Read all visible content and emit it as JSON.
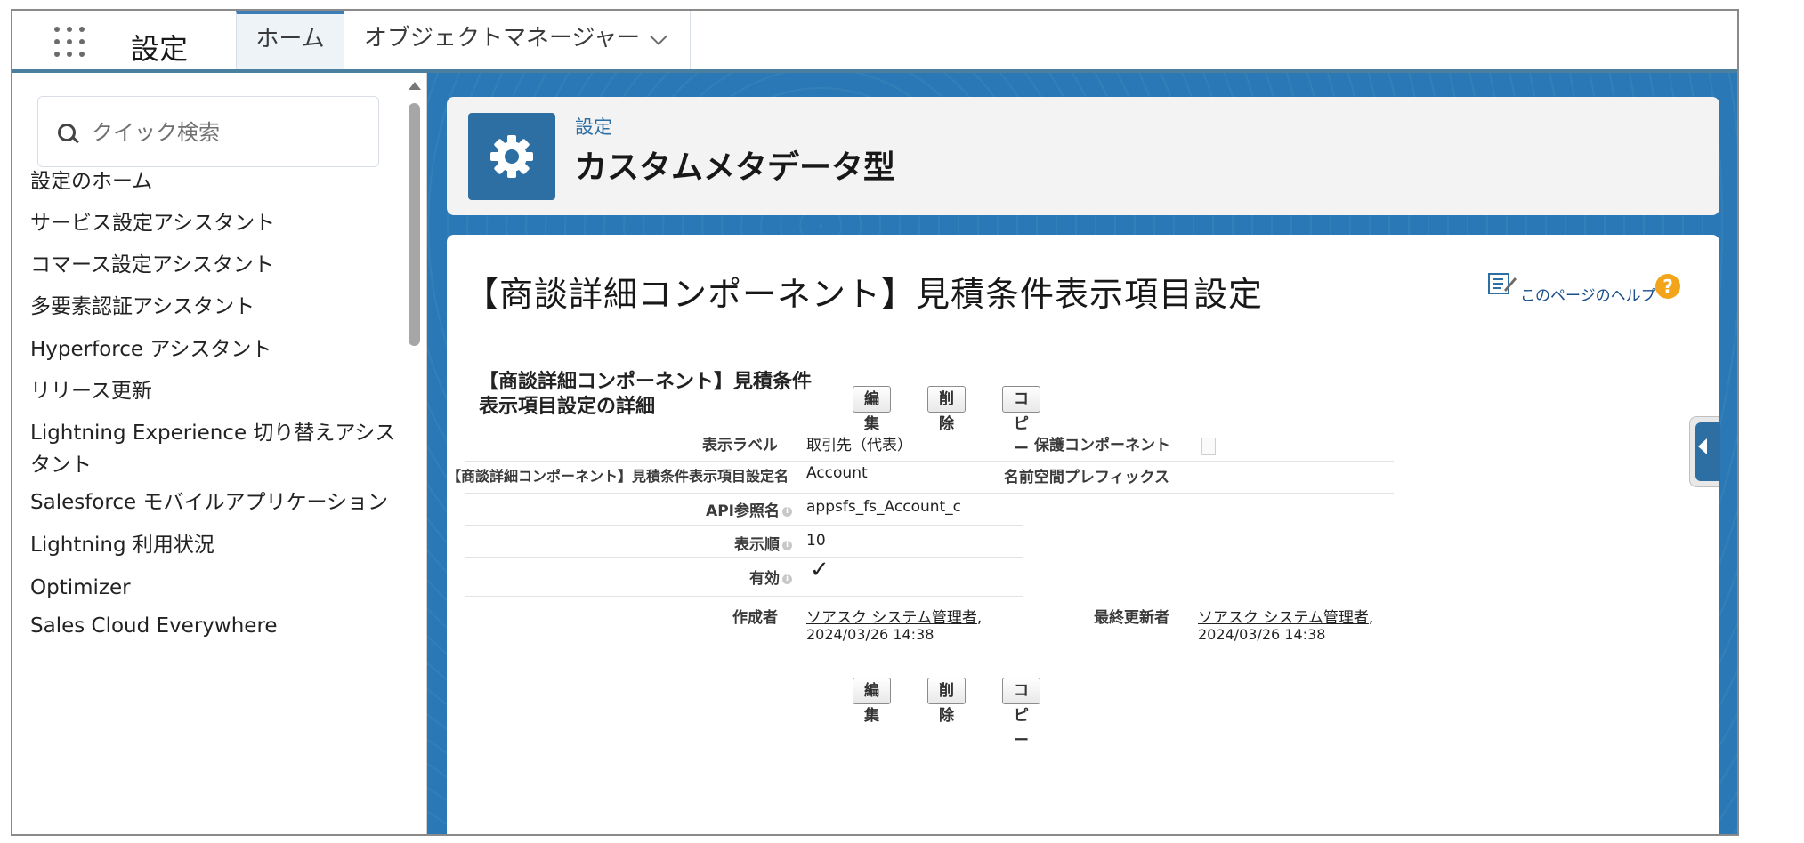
{
  "topbar": {
    "app_name": "設定",
    "tabs": [
      {
        "label": "ホーム"
      },
      {
        "label": "オブジェクトマネージャー"
      }
    ]
  },
  "sidebar": {
    "search_placeholder": "クイック検索",
    "items": [
      {
        "label": "設定のホーム"
      },
      {
        "label": "サービス設定アシスタント"
      },
      {
        "label": "コマース設定アシスタント"
      },
      {
        "label": "多要素認証アシスタント"
      },
      {
        "label": "Hyperforce アシスタント"
      },
      {
        "label": "リリース更新"
      },
      {
        "label": "Lightning Experience 切り替えアシスタント"
      },
      {
        "label": "Salesforce モバイルアプリケーション"
      },
      {
        "label": "Lightning 利用状況"
      },
      {
        "label": "Optimizer"
      },
      {
        "label": "Sales Cloud Everywhere"
      }
    ]
  },
  "header": {
    "breadcrumb": "設定",
    "title": "カスタムメタデータ型"
  },
  "content": {
    "title": "【商談詳細コンポーネント】見積条件表示項目設定",
    "help_text": "このページのヘルプ",
    "detail_title": "【商談詳細コンポーネント】見積条件表示項目設定の詳細",
    "buttons": {
      "edit": "編集",
      "delete": "削除",
      "copy": "コピー"
    },
    "fields": {
      "display_label": {
        "label": "表示ラベル",
        "value": "取引先（代表）"
      },
      "protected_component": {
        "label": "保護コンポーネント"
      },
      "record_name": {
        "label": "【商談詳細コンポーネント】見積条件表示項目設定名",
        "value": "Account"
      },
      "namespace_prefix": {
        "label": "名前空間プレフィックス"
      },
      "api_name": {
        "label": "API参照名",
        "value": "appsfs_fs_Account_c"
      },
      "display_order": {
        "label": "表示順",
        "value": "10"
      },
      "active": {
        "label": "有効",
        "value": "✓"
      },
      "created_by": {
        "label": "作成者",
        "user": "ソアスク システム管理者",
        "date": "2024/03/26 14:38"
      },
      "last_modified_by": {
        "label": "最終更新者",
        "user": "ソアスク システム管理者",
        "date": "2024/03/26 14:38"
      }
    }
  },
  "colors": {
    "accent_blue": "#2e6fa3",
    "main_background": "#2a78b5",
    "help_icon": "#f2a51a"
  }
}
